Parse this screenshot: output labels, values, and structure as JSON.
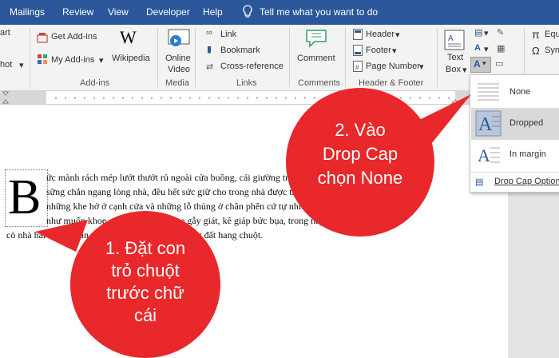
{
  "menubar": {
    "tabs": [
      "Mailings",
      "Review",
      "View",
      "Developer",
      "Help"
    ],
    "tell_me": "Tell me what you want to do"
  },
  "ribbon": {
    "partial_left_1": "art",
    "partial_left_2": "hot",
    "get_addins": "Get Add-ins",
    "my_addins": "My Add-ins",
    "wikipedia": "Wikipedia",
    "online_video_1": "Online",
    "online_video_2": "Video",
    "link": "Link",
    "bookmark": "Bookmark",
    "cross_reference": "Cross-reference",
    "comment": "Comment",
    "header": "Header",
    "footer": "Footer",
    "page_number": "Page Number",
    "text_box_1": "Text",
    "text_box_2": "Box",
    "equation": "Equ",
    "symbol": "Syn",
    "groups": {
      "addins": "Add-ins",
      "media": "Media",
      "links": "Links",
      "comments": "Comments",
      "header_footer": "Header & Footer"
    }
  },
  "dropdown": {
    "items": [
      "None",
      "Dropped",
      "In margin"
    ],
    "options": "Drop Cap Options..."
  },
  "document": {
    "dropcap": "B",
    "lines": [
      "ức mành rách mép lướt thướt rủ ngoài cửa buồng, cái giường tre gẫy giát nằm sừng",
      "sững chắn ngang lòng nhà, đều hết sức giữ cho trong nhà được thật tối tăm. Trái lại,",
      "những khe hở ở cạnh cửa và những lỗ thủng ở chân phên cứ tự nhiên phô sòng,",
      "như muốn khoe cái chiếc giường tre gẫy giát, kê giáp bức bụa, trong này",
      "cò nhà hai dầu có sân, nằm sát cạnh bên cạnh đống đất hang chuột."
    ]
  },
  "callouts": {
    "step1": [
      "1. Đặt con",
      "trỏ chuột",
      "trước chữ",
      "cái"
    ],
    "step2": [
      "2. Vào",
      "Drop Cap",
      "chọn None"
    ]
  },
  "colors": {
    "menubar": "#2b579a",
    "callout": "#e8282a",
    "highlight": "#c5c5c5"
  }
}
